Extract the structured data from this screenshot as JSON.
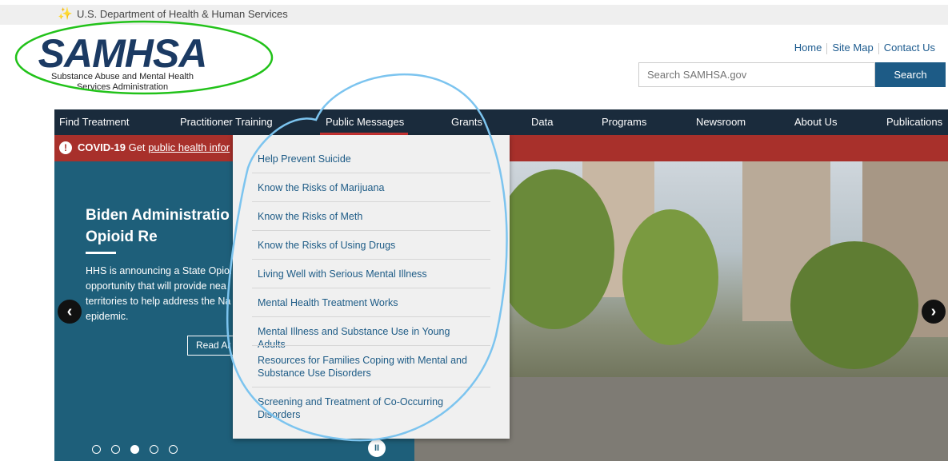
{
  "hhs_bar": {
    "text": "U.S. Department of Health & Human Services",
    "icon": "eagle-icon"
  },
  "logo": {
    "word": "SAMHSA",
    "sub1": "Substance Abuse and Mental Health",
    "sub2": "Services Administration"
  },
  "utility_links": [
    "Home",
    "Site Map",
    "Contact Us"
  ],
  "search": {
    "placeholder": "Search SAMHSA.gov",
    "button": "Search"
  },
  "nav": [
    "Find Treatment",
    "Practitioner Training",
    "Public Messages",
    "Grants",
    "Data",
    "Programs",
    "Newsroom",
    "About Us",
    "Publications"
  ],
  "covid": {
    "label": "COVID-19",
    "text": "Get",
    "link": "public health infor"
  },
  "slide": {
    "title": "Biden Administratio for State Opioid Re",
    "body": "HHS is announcing a State Opioi opportunity that will provide nea territories to help address the Na epidemic.",
    "button": "Read Ar",
    "dots": 5,
    "active_dot": 3
  },
  "dropdown": [
    "Help Prevent Suicide",
    "Know the Risks of Marijuana",
    "Know the Risks of Meth",
    "Know the Risks of Using Drugs",
    "Living Well with Serious Mental Illness",
    "Mental Health Treatment Works",
    "Mental Illness and Substance Use in Young Adults",
    "Resources for Families Coping with Mental and Substance Use Disorders",
    "Screening and Treatment of Co-Occurring Disorders"
  ],
  "colors": {
    "nav_bg": "#1a2b3c",
    "covid_bg": "#a8302b",
    "slide_bg": "#1e5f7a",
    "link": "#1d5b86",
    "annotation_green": "#22c21a",
    "annotation_blue": "#7cc4ef"
  }
}
